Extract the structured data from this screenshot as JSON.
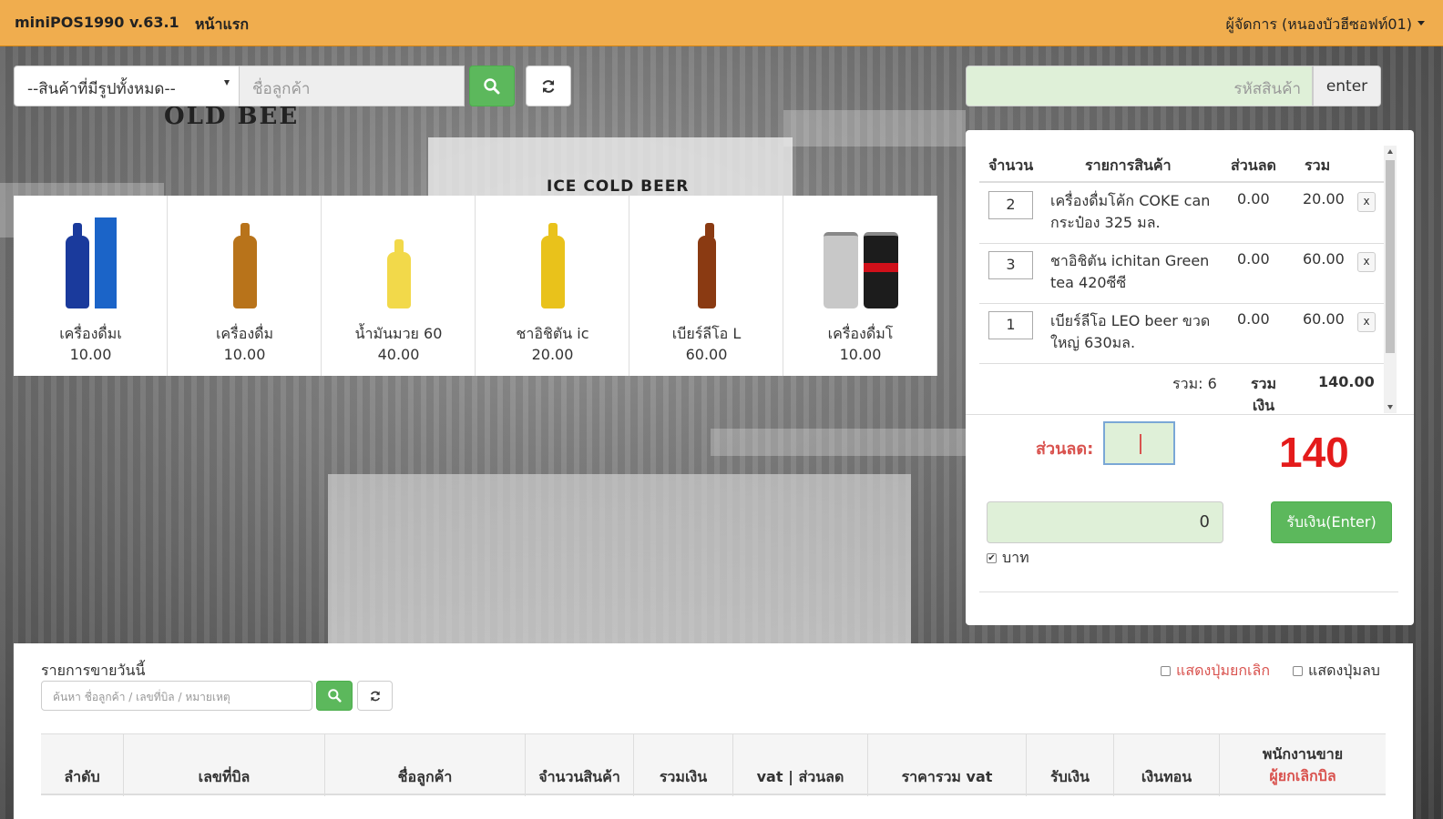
{
  "navbar": {
    "brand": "miniPOS1990 v.63.1",
    "home": "หน้าแรก",
    "user": "ผู้จัดการ (หนองบัวฮีซอฟท์01)"
  },
  "search": {
    "category_selected": "--สินค้าที่มีรูปทั้งหมด--",
    "customer_placeholder": "ชื่อลูกค้า",
    "product_code_placeholder": "รหัสสินค้า",
    "enter_label": "enter"
  },
  "products": [
    {
      "name": "เครื่องดื่มเ",
      "price": "10.00",
      "icon": "pepsi-bottle-icon"
    },
    {
      "name": "เครื่องดื่ม",
      "price": "10.00",
      "icon": "m150-bottle-icon"
    },
    {
      "name": "น้ำมันมวย 60",
      "price": "40.00",
      "icon": "oil-bottle-icon"
    },
    {
      "name": "ชาอิชิตัน ic",
      "price": "20.00",
      "icon": "ichitan-bottle-icon"
    },
    {
      "name": "เบียร์ลีโอ L",
      "price": "60.00",
      "icon": "leo-bottle-icon"
    },
    {
      "name": "เครื่องดื่มโ",
      "price": "10.00",
      "icon": "coke-can-icon"
    }
  ],
  "cart": {
    "headers": {
      "qty": "จำนวน",
      "item": "รายการสินค้า",
      "discount": "ส่วนลด",
      "total": "รวม"
    },
    "rows": [
      {
        "qty": "2",
        "item": "เครื่องดื่มโค้ก COKE can กระป๋อง 325 มล.",
        "discount": "0.00",
        "total": "20.00",
        "remove": "x"
      },
      {
        "qty": "3",
        "item": "ชาอิชิตัน ichitan Green tea 420ซีซี",
        "discount": "0.00",
        "total": "60.00",
        "remove": "x"
      },
      {
        "qty": "1",
        "item": "เบียร์ลีโอ LEO beer ขวดใหญ่ 630มล.",
        "discount": "0.00",
        "total": "60.00",
        "remove": "x"
      }
    ],
    "count_label": "รวม: 6",
    "sum_label": "รวม เงิน",
    "sum_value": "140.00"
  },
  "payment": {
    "discount_label": "ส่วนลด:",
    "discount_value": "",
    "grand_total": "140",
    "received_value": "0",
    "pay_button": "รับเงิน(Enter)",
    "baht_label": "บาท",
    "baht_checked": true
  },
  "sales": {
    "title": "รายการขายวันนี้",
    "search_placeholder": "ค้นหา ชื่อลูกค้า / เลขที่บิล / หมายเหตุ",
    "show_cancel_label": "แสดงปุ่มยกเลิก",
    "show_delete_label": "แสดงปุ่มลบ",
    "columns": [
      "ลำดับ",
      "เลขที่บิล",
      "ชื่อลูกค้า",
      "จำนวนสินค้า",
      "รวมเงิน",
      "vat | ส่วนลด",
      "ราคารวม vat",
      "รับเงิน",
      "เงินทอน"
    ],
    "last_column_line1": "พนักงานขาย",
    "last_column_line2": "ผู้ยกเลิกบิล"
  },
  "background": {
    "sign_text": "ICE COLD BEER",
    "beer_text": "OLD BEE"
  },
  "colors": {
    "navbar": "#f0ad4e",
    "success": "#5cb85c",
    "danger": "#d9534f",
    "input_green": "#dff0d8",
    "total_red": "#e41b1b"
  }
}
